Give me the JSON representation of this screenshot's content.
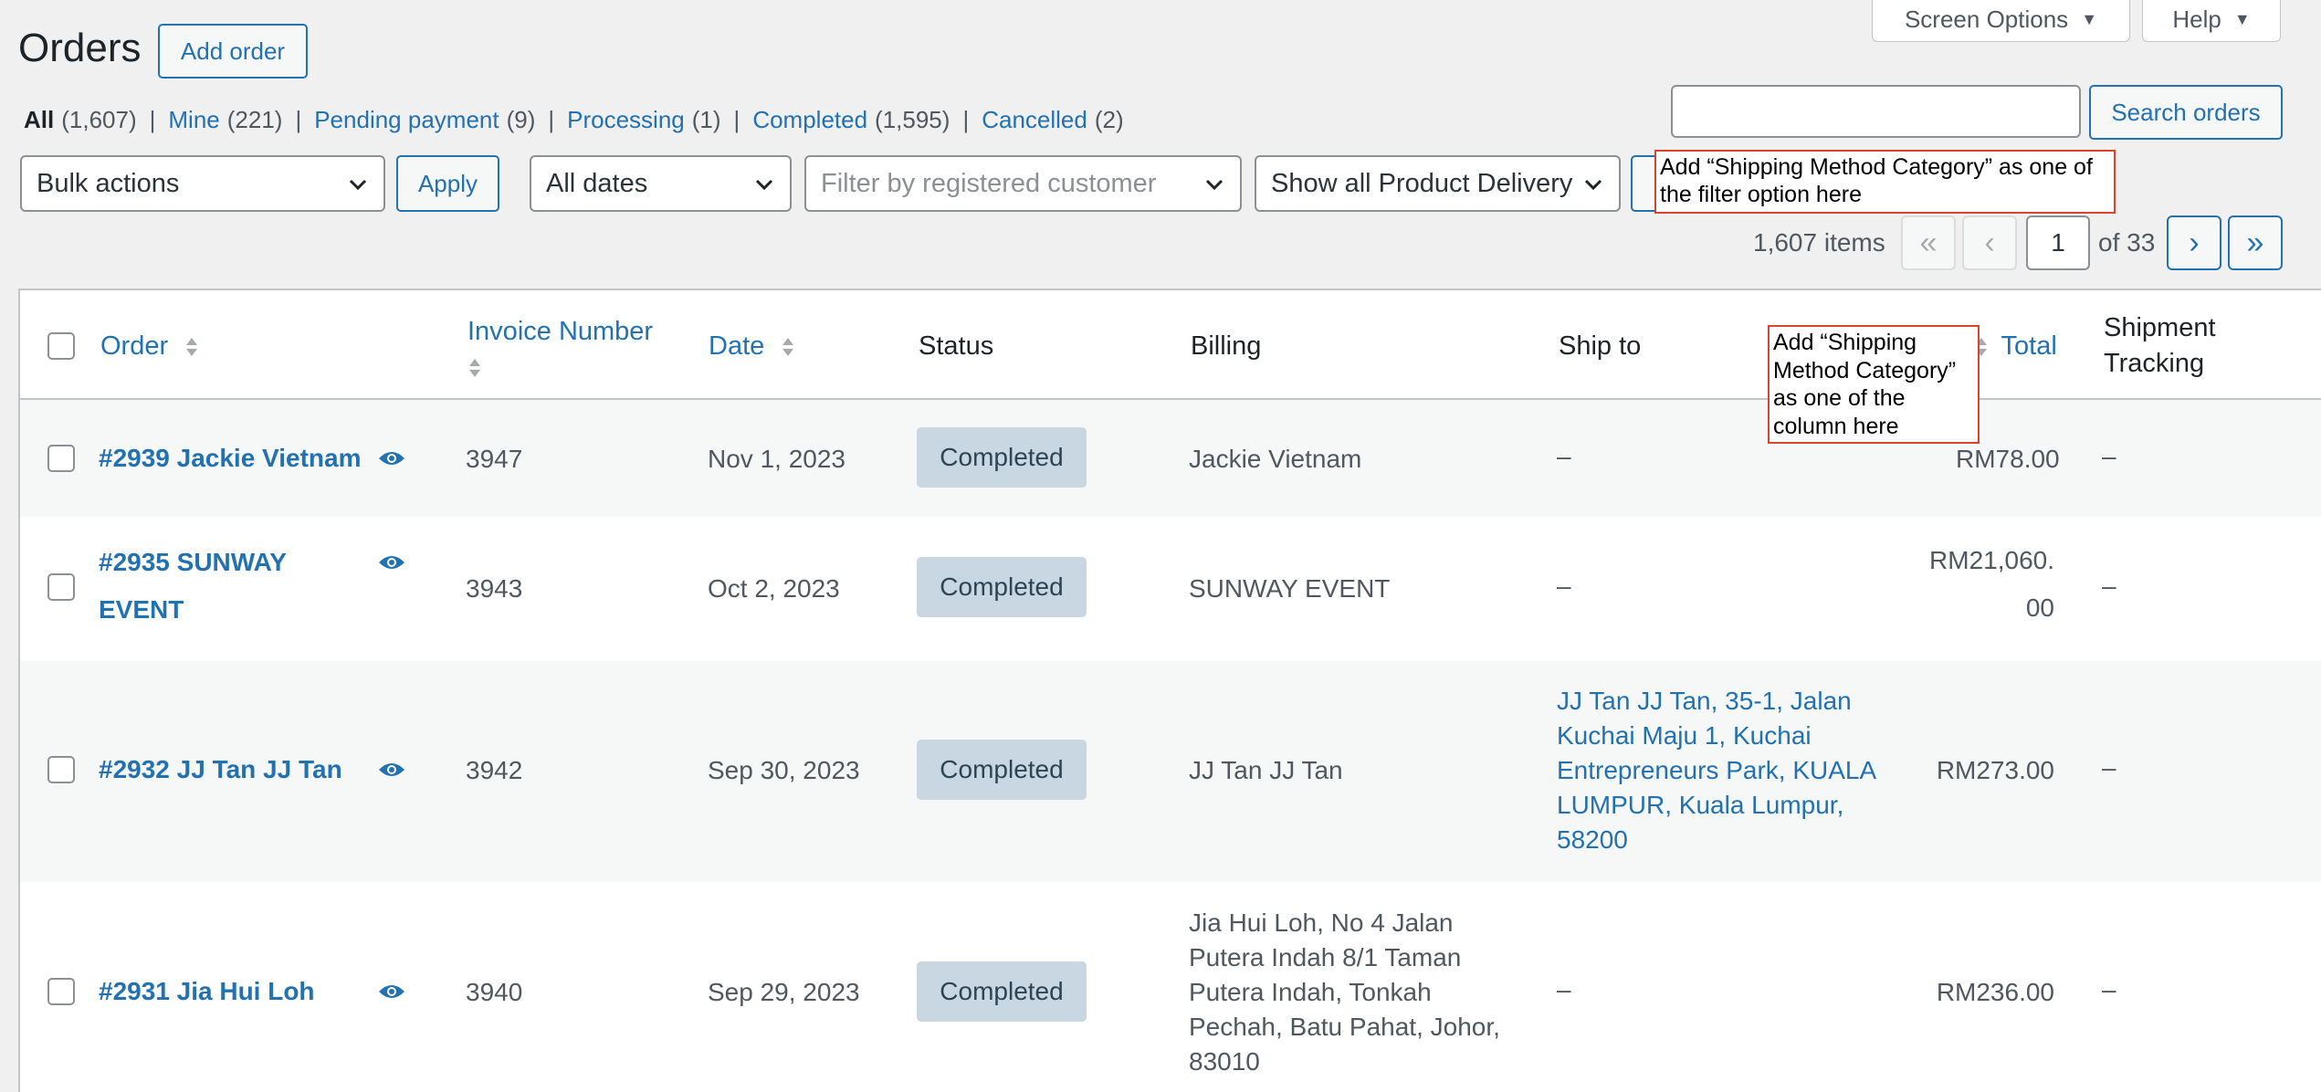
{
  "header": {
    "screen_options_label": "Screen Options",
    "help_label": "Help",
    "page_title": "Orders",
    "add_order_label": "Add order"
  },
  "status_filters": [
    {
      "label": "All",
      "count": "(1,607)"
    },
    {
      "label": "Mine",
      "count": "(221)"
    },
    {
      "label": "Pending payment",
      "count": "(9)"
    },
    {
      "label": "Processing",
      "count": "(1)"
    },
    {
      "label": "Completed",
      "count": "(1,595)"
    },
    {
      "label": "Cancelled",
      "count": "(2)"
    }
  ],
  "search": {
    "value": "",
    "button_label": "Search orders"
  },
  "filters": {
    "bulk_actions": "Bulk actions",
    "apply_label": "Apply",
    "dates": "All dates",
    "customer_placeholder": "Filter by registered customer",
    "product_delivery": "Show all Product Delivery"
  },
  "annotations": {
    "filter_note": "Add “Shipping Method Category” as one of the filter option here",
    "column_note": "Add “Shipping Method Category” as one of the column here"
  },
  "pagination": {
    "items": "1,607 items",
    "first": "«",
    "prev": "‹",
    "current_page": "1",
    "of_total": "of 33",
    "next": "›",
    "last": "»"
  },
  "table": {
    "columns": {
      "order": "Order",
      "invoice": "Invoice Number",
      "date": "Date",
      "status": "Status",
      "billing": "Billing",
      "ship_to": "Ship to",
      "total": "Total",
      "tracking": "Shipment Tracking"
    },
    "rows": [
      {
        "order_line1": "#2939 Jackie Vietnam",
        "order_line2": "",
        "invoice": "3947",
        "date": "Nov 1, 2023",
        "status": "Completed",
        "billing": "Jackie Vietnam",
        "ship_to": "–",
        "total": "RM78.00",
        "tracking": "–"
      },
      {
        "order_line1": "#2935 SUNWAY",
        "order_line2": "EVENT",
        "invoice": "3943",
        "date": "Oct 2, 2023",
        "status": "Completed",
        "billing": "SUNWAY EVENT",
        "ship_to": "–",
        "total_line1": "RM21,060.",
        "total_line2": "00",
        "tracking": "–"
      },
      {
        "order_line1": "#2932 JJ Tan JJ Tan",
        "order_line2": "",
        "invoice": "3942",
        "date": "Sep 30, 2023",
        "status": "Completed",
        "billing": "JJ Tan JJ Tan",
        "ship_to_lines": [
          "JJ Tan JJ Tan, 35-1, Jalan",
          "Kuchai Maju 1, Kuchai",
          "Entrepreneurs Park, KUALA",
          "LUMPUR, Kuala Lumpur,",
          "58200"
        ],
        "total": "RM273.00",
        "tracking": "–"
      },
      {
        "order_line1": "#2931 Jia Hui Loh",
        "order_line2": "",
        "invoice": "3940",
        "date": "Sep 29, 2023",
        "status": "Completed",
        "billing_lines": [
          "Jia Hui Loh, No 4 Jalan",
          "Putera Indah 8/1 Taman",
          "Putera Indah, Tonkah",
          "Pechah, Batu Pahat, Johor,",
          "83010"
        ],
        "ship_to": "–",
        "total": "RM236.00",
        "tracking": "–"
      }
    ]
  },
  "colors": {
    "link": "#2271b1",
    "badge_bg": "#c8d7e1",
    "annotation_border": "#d9442c"
  }
}
